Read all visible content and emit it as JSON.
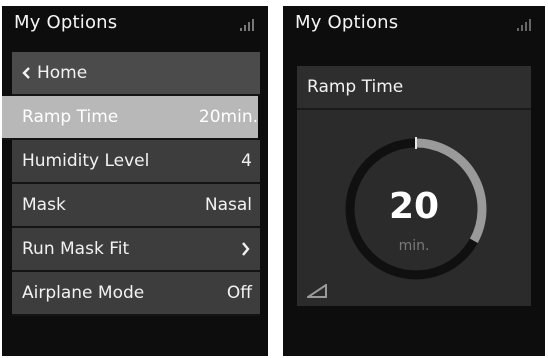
{
  "left_screen": {
    "title": "My Options",
    "status_icon": "signal-icon",
    "home": {
      "label": "Home",
      "icon": "chevron-left-icon"
    },
    "items": [
      {
        "label": "Ramp Time",
        "value": "20min.",
        "selected": true
      },
      {
        "label": "Humidity Level",
        "value": "4"
      },
      {
        "label": "Mask",
        "value": "Nasal"
      },
      {
        "label": "Run Mask Fit",
        "value": "",
        "icon": "chevron-right-icon"
      },
      {
        "label": "Airplane Mode",
        "value": "Off"
      }
    ]
  },
  "right_screen": {
    "title": "My Options",
    "status_icon": "signal-icon",
    "panel_title": "Ramp Time",
    "dial": {
      "value": "20",
      "unit": "min.",
      "level_fraction": 0.33
    },
    "footer_icon": "ramp-icon"
  },
  "colors": {
    "background": "#0d0d0d",
    "menu_item": "#3d3d3d",
    "selected_item": "#b8b8b8",
    "dial_track": "#101010",
    "dial_fill": "#9a9a9a"
  }
}
